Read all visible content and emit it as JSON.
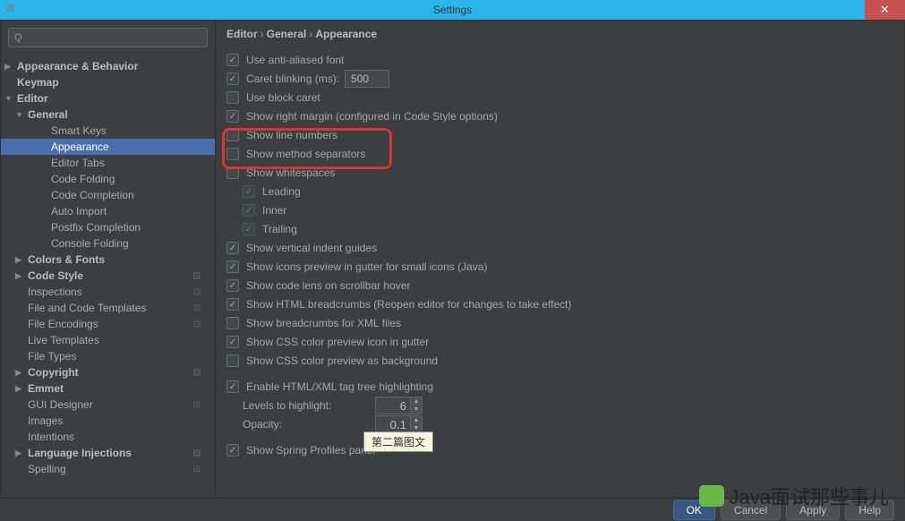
{
  "window": {
    "title": "Settings"
  },
  "breadcrumb": {
    "a": "Editor",
    "b": "General",
    "c": "Appearance"
  },
  "sidebar": {
    "appearance_behavior": "Appearance & Behavior",
    "keymap": "Keymap",
    "editor": "Editor",
    "general": "General",
    "smart_keys": "Smart Keys",
    "appearance": "Appearance",
    "editor_tabs": "Editor Tabs",
    "code_folding": "Code Folding",
    "code_completion": "Code Completion",
    "auto_import": "Auto Import",
    "postfix_completion": "Postfix Completion",
    "console_folding": "Console Folding",
    "colors_fonts": "Colors & Fonts",
    "code_style": "Code Style",
    "inspections": "Inspections",
    "file_code_templates": "File and Code Templates",
    "file_encodings": "File Encodings",
    "live_templates": "Live Templates",
    "file_types": "File Types",
    "copyright": "Copyright",
    "emmet": "Emmet",
    "gui_designer": "GUI Designer",
    "images": "Images",
    "intentions": "Intentions",
    "language_injections": "Language Injections",
    "spelling": "Spelling"
  },
  "options": {
    "anti_aliased": "Use anti-aliased font",
    "caret_blinking": "Caret blinking (ms):",
    "caret_blinking_value": "500",
    "use_block_caret": "Use block caret",
    "show_right_margin": "Show right margin (configured in Code Style options)",
    "show_line_numbers": "Show line numbers",
    "show_method_separators": "Show method separators",
    "show_whitespaces": "Show whitespaces",
    "leading": "Leading",
    "inner": "Inner",
    "trailing": "Trailing",
    "show_vertical_indent": "Show vertical indent guides",
    "show_icons_preview": "Show icons preview in gutter for small icons (Java)",
    "show_code_lens": "Show code lens on scrollbar hover",
    "show_html_breadcrumbs": "Show HTML breadcrumbs (Reopen editor for changes to take effect)",
    "show_xml_breadcrumbs": "Show breadcrumbs for XML files",
    "show_css_preview_gutter": "Show CSS color preview icon in gutter",
    "show_css_preview_bg": "Show CSS color preview as background",
    "enable_tag_tree": "Enable HTML/XML tag tree highlighting",
    "levels_to_highlight": "Levels to highlight:",
    "levels_value": "6",
    "opacity": "Opacity:",
    "opacity_value": "0.1",
    "show_spring_profiles": "Show Spring Profiles panel"
  },
  "tooltip": "第二篇图文",
  "buttons": {
    "ok": "OK",
    "cancel": "Cancel",
    "apply": "Apply",
    "help": "Help"
  },
  "watermark": "Java面试那些事儿"
}
